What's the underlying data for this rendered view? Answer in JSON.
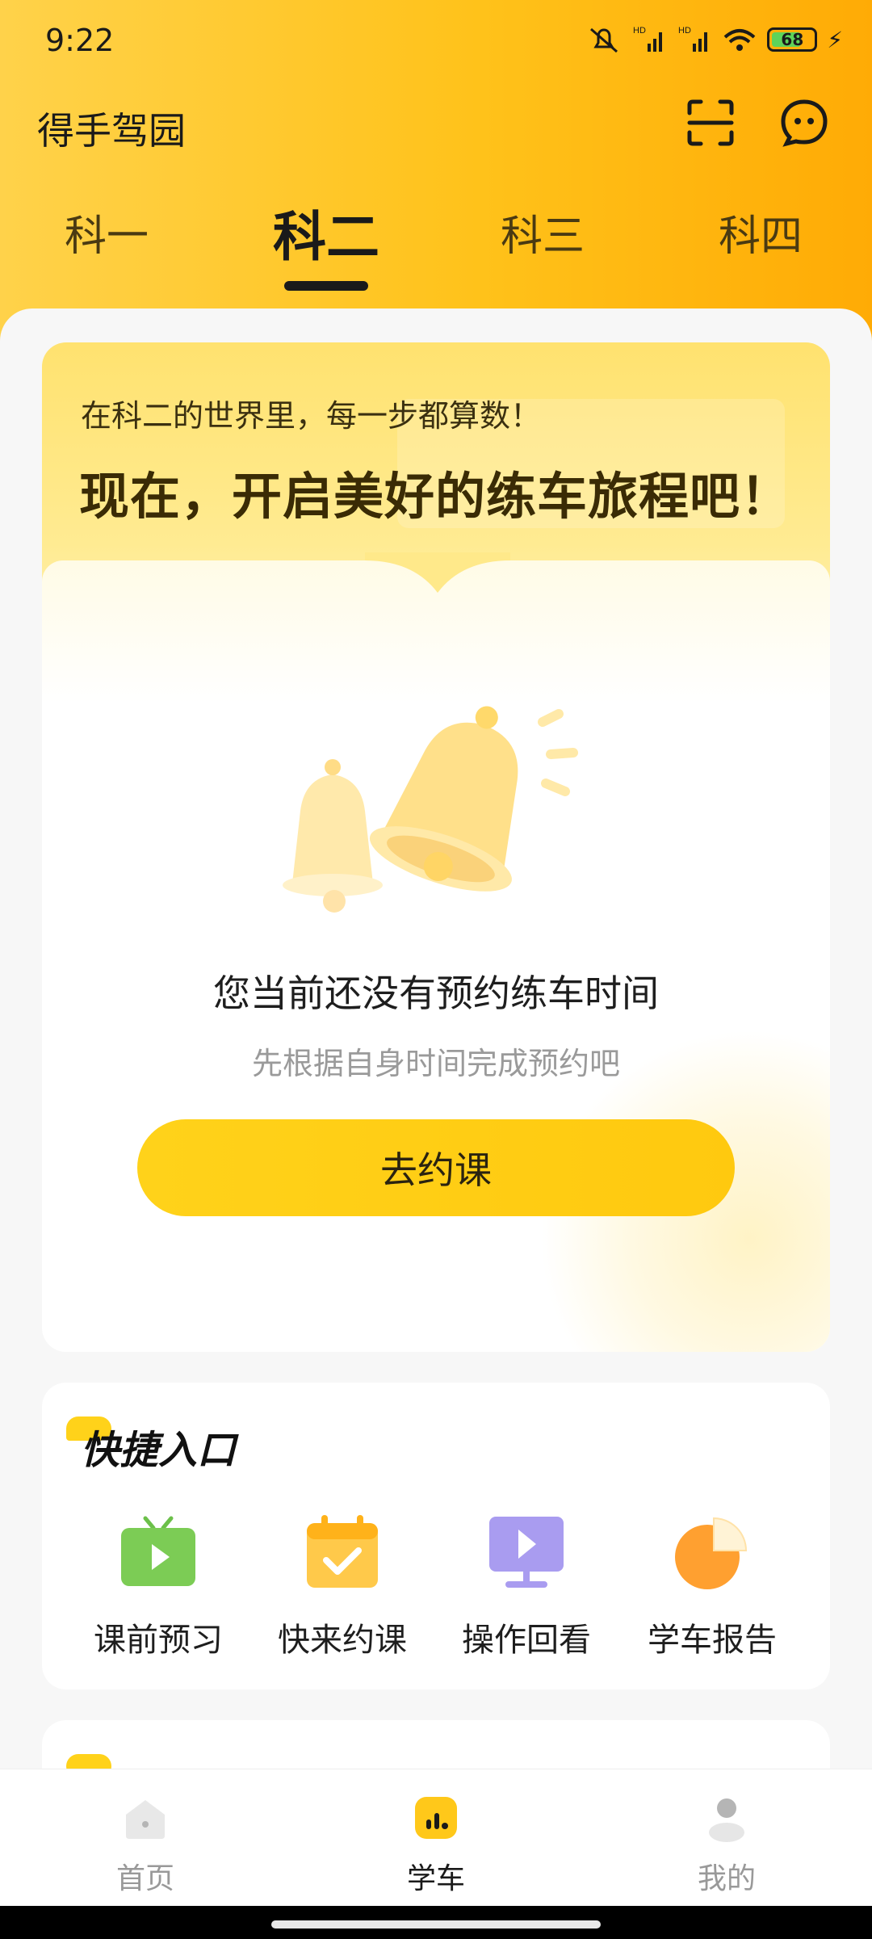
{
  "status_bar": {
    "time": "9:22",
    "battery": "68",
    "net_label_1": "HD",
    "net_label_2": "HD"
  },
  "header": {
    "title": "得手驾园"
  },
  "tabs": [
    {
      "label": "科一"
    },
    {
      "label": "科二"
    },
    {
      "label": "科三"
    },
    {
      "label": "科四"
    }
  ],
  "active_tab": "科二",
  "main_card": {
    "subtitle": "在科二的世界里，每一步都算数！",
    "headline": "现在，开启美好的练车旅程吧！",
    "empty_title": "您当前还没有预约练车时间",
    "empty_subtitle": "先根据自身时间完成预约吧",
    "button_label": "去约课"
  },
  "quick_entry": {
    "title": "快捷入口",
    "items": [
      {
        "label": "课前预习",
        "icon": "tv-play-icon"
      },
      {
        "label": "快来约课",
        "icon": "calendar-check-icon"
      },
      {
        "label": "操作回看",
        "icon": "monitor-play-icon"
      },
      {
        "label": "学车报告",
        "icon": "report-pie-icon"
      }
    ]
  },
  "bottom_nav": [
    {
      "label": "首页",
      "icon": "home-icon",
      "active": false
    },
    {
      "label": "学车",
      "icon": "learn-chart-icon",
      "active": true
    },
    {
      "label": "我的",
      "icon": "profile-icon",
      "active": false
    }
  ],
  "colors": {
    "accent": "#FFC90F",
    "header_gradient_end": "#FFAB05",
    "text_dark": "#1A1A1A"
  }
}
